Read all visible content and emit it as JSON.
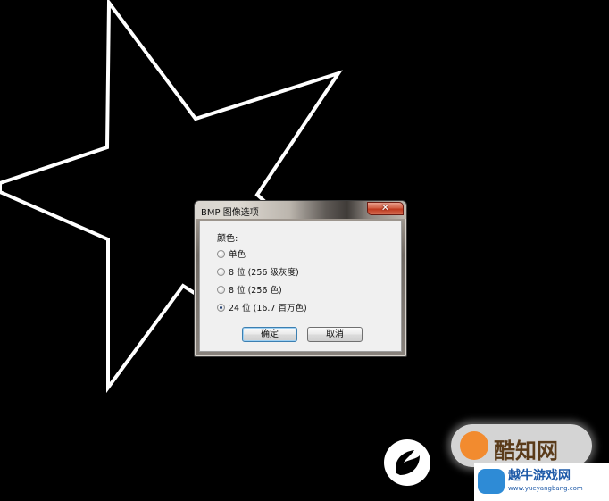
{
  "dialog": {
    "title": "BMP 图像选项",
    "close_label": "✕",
    "group_label": "颜色:",
    "options": [
      {
        "label": "单色",
        "checked": false
      },
      {
        "label": "8 位 (256 级灰度)",
        "checked": false
      },
      {
        "label": "8 位 (256 色)",
        "checked": false
      },
      {
        "label": "24 位 (16.7 百万色)",
        "checked": true
      }
    ],
    "ok_label": "确定",
    "cancel_label": "取消"
  },
  "watermark": {
    "ribbon_text": "酷知网",
    "box_title": "越牛游戏网",
    "box_url": "www.yueyangbang.com"
  },
  "colors": {
    "background": "#000000",
    "star_outline": "#ffffff",
    "close_button": "#c7452a"
  },
  "icons": {
    "close": "close-icon",
    "radio": "radio-icon"
  }
}
